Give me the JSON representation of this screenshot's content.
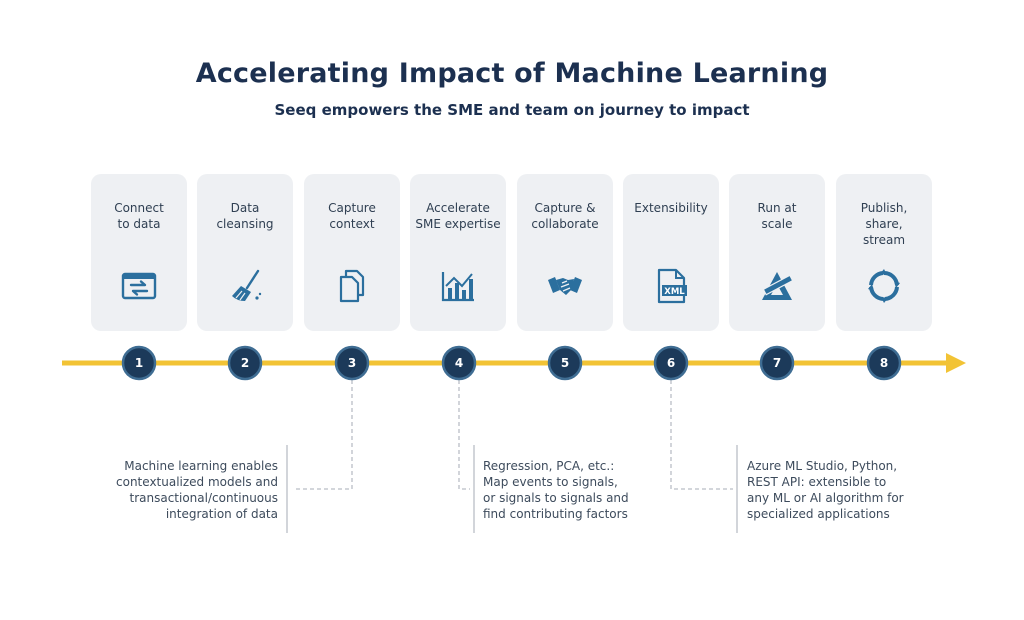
{
  "header": {
    "title": "Accelerating Impact of Machine Learning",
    "subtitle": "Seeq empowers the SME and team on journey to impact"
  },
  "colors": {
    "navy": "#1c3a5a",
    "icon_blue": "#2b6f9e",
    "timeline_yellow": "#f2c335",
    "card_bg": "#eef0f3",
    "connector_gray": "#b9bec5"
  },
  "steps": [
    {
      "number": "1",
      "label": "Connect\nto data",
      "icon": "data-transfer-icon"
    },
    {
      "number": "2",
      "label": "Data\ncleansing",
      "icon": "broom-icon"
    },
    {
      "number": "3",
      "label": "Capture\ncontext",
      "icon": "documents-icon"
    },
    {
      "number": "4",
      "label": "Accelerate\nSME expertise",
      "icon": "bar-chart-icon"
    },
    {
      "number": "5",
      "label": "Capture &\ncollaborate",
      "icon": "handshake-icon"
    },
    {
      "number": "6",
      "label": "Extensibility",
      "icon": "xml-file-icon"
    },
    {
      "number": "7",
      "label": "Run at\nscale",
      "icon": "set-square-ruler-icon"
    },
    {
      "number": "8",
      "label": "Publish,\nshare,\nstream",
      "icon": "cycle-arrows-icon"
    }
  ],
  "notes": [
    {
      "step": "3",
      "text": "Machine learning enables\ncontextualized models and\ntransactional/continuous\nintegration of data"
    },
    {
      "step": "4",
      "text": "Regression, PCA, etc.:\nMap events to signals,\nor signals to signals and\nfind contributing factors"
    },
    {
      "step": "6",
      "text": "Azure ML Studio, Python,\nREST API: extensible to\nany ML or AI algorithm for\nspecialized applications"
    }
  ]
}
